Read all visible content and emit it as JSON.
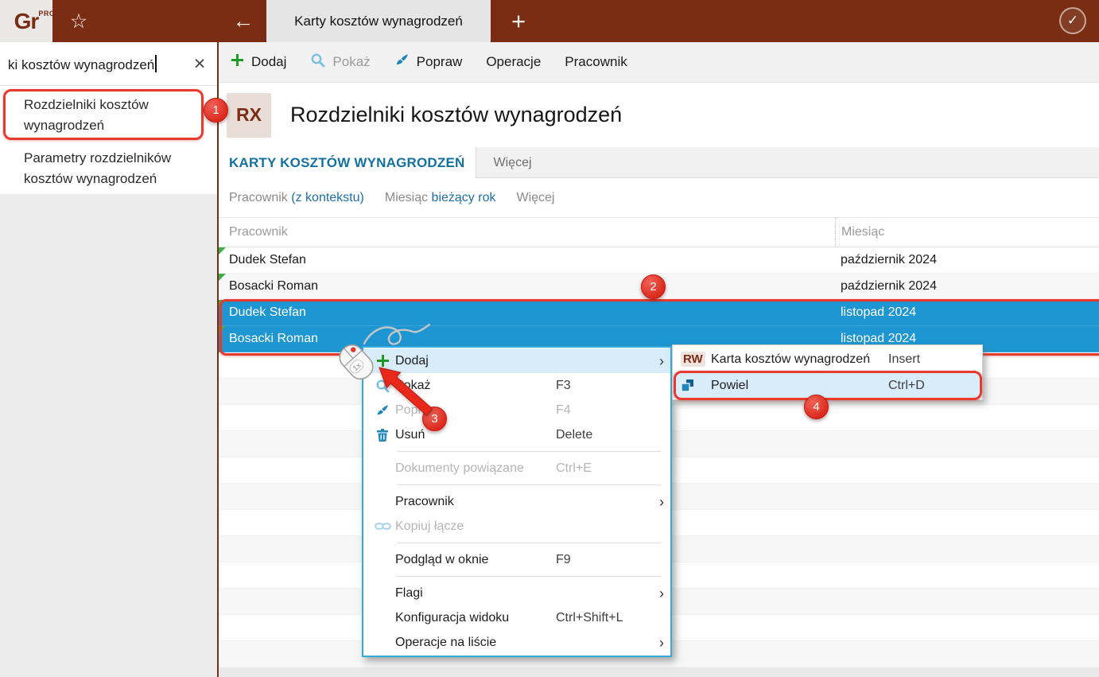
{
  "colors": {
    "brand_maroon": "#7a2d13",
    "selection_blue": "#1e96d2",
    "annotation_red": "#e8392c",
    "menu_highlight": "#d8edf9",
    "link_blue": "#1d6fa5",
    "action_green": "#1f9a27"
  },
  "topbar": {
    "logo": {
      "text": "Gr",
      "sup": "PRO"
    },
    "tab": {
      "title": "Karty kosztów wynagrodzeń"
    }
  },
  "sidebar": {
    "search": {
      "value": "ki kosztów wynagrodzeń"
    },
    "items": [
      {
        "label": "Rozdzielniki kosztów wynagrodzeń"
      },
      {
        "label": "Parametry rozdzielników kosztów wynagrodzeń"
      }
    ]
  },
  "toolbar": {
    "items": [
      {
        "label": "Dodaj",
        "icon": "plus-icon",
        "disabled": false
      },
      {
        "label": "Pokaż",
        "icon": "search-icon",
        "disabled": true
      },
      {
        "label": "Popraw",
        "icon": "brush-icon",
        "disabled": false
      },
      {
        "label": "Operacje",
        "icon": null,
        "disabled": false
      },
      {
        "label": "Pracownik",
        "icon": null,
        "disabled": false
      }
    ]
  },
  "header": {
    "doc_badge": "RX",
    "title": "Rozdzielniki kosztów wynagrodzeń"
  },
  "view_tabs": [
    {
      "label": "KARTY KOSZTÓW WYNAGRODZEŃ",
      "active": true
    },
    {
      "label": "Więcej",
      "active": false
    }
  ],
  "filters": [
    {
      "label": "Pracownik",
      "value": "(z kontekstu)"
    },
    {
      "label": "Miesiąc",
      "value": "bieżący rok"
    },
    {
      "label": "Więcej",
      "value": ""
    }
  ],
  "table": {
    "columns": [
      {
        "label": "Pracownik"
      },
      {
        "label": "Miesiąc"
      }
    ],
    "rows": [
      {
        "pracownik": "Dudek Stefan",
        "miesiac": "październik 2024",
        "selected": false,
        "flagged": true
      },
      {
        "pracownik": "Bosacki Roman",
        "miesiac": "październik 2024",
        "selected": false,
        "flagged": true
      },
      {
        "pracownik": "Dudek Stefan",
        "miesiac": "listopad 2024",
        "selected": true,
        "flagged": true
      },
      {
        "pracownik": "Bosacki Roman",
        "miesiac": "listopad 2024",
        "selected": true,
        "flagged": true
      }
    ],
    "empty_row_count": 12
  },
  "context_menu": {
    "items": [
      {
        "type": "item",
        "icon": "plus-icon",
        "label": "Dodaj",
        "shortcut": "",
        "submenu": true,
        "state": "highlighted"
      },
      {
        "type": "item",
        "icon": "search-icon",
        "label": "Pokaż",
        "shortcut": "F3",
        "submenu": false,
        "state": "normal"
      },
      {
        "type": "item",
        "icon": "brush-icon",
        "label": "Popraw",
        "shortcut": "F4",
        "submenu": false,
        "state": "disabled"
      },
      {
        "type": "item",
        "icon": "trash-icon",
        "label": "Usuń",
        "shortcut": "Delete",
        "submenu": false,
        "state": "normal"
      },
      {
        "type": "separator"
      },
      {
        "type": "item",
        "icon": null,
        "label": "Dokumenty powiązane",
        "shortcut": "Ctrl+E",
        "submenu": false,
        "state": "disabled"
      },
      {
        "type": "separator"
      },
      {
        "type": "item",
        "icon": null,
        "label": "Pracownik",
        "shortcut": "",
        "submenu": true,
        "state": "normal"
      },
      {
        "type": "item",
        "icon": "link-icon",
        "label": "Kopiuj łącze",
        "shortcut": "",
        "submenu": false,
        "state": "disabled"
      },
      {
        "type": "separator"
      },
      {
        "type": "item",
        "icon": null,
        "label": "Podgląd w oknie",
        "shortcut": "F9",
        "submenu": false,
        "state": "normal"
      },
      {
        "type": "separator"
      },
      {
        "type": "item",
        "icon": null,
        "label": "Flagi",
        "shortcut": "",
        "submenu": true,
        "state": "normal"
      },
      {
        "type": "item",
        "icon": null,
        "label": "Konfiguracja widoku",
        "shortcut": "Ctrl+Shift+L",
        "submenu": false,
        "state": "normal"
      },
      {
        "type": "item",
        "icon": null,
        "label": "Operacje na liście",
        "shortcut": "",
        "submenu": true,
        "state": "normal"
      }
    ]
  },
  "submenu": {
    "items": [
      {
        "badge": "RW",
        "icon": null,
        "label": "Karta kosztów wynagrodzeń",
        "shortcut": "Insert",
        "highlighted": false
      },
      {
        "badge": null,
        "icon": "duplicate-icon",
        "label": "Powiel",
        "shortcut": "Ctrl+D",
        "highlighted": true
      }
    ]
  },
  "annotations": {
    "badges": [
      "1",
      "2",
      "3",
      "4"
    ],
    "click_label": "1x"
  }
}
